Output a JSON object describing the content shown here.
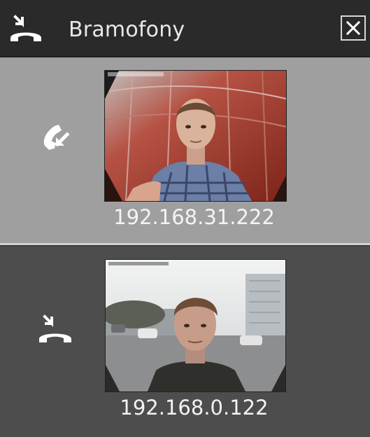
{
  "window": {
    "title": "Bramofony",
    "title_icon": "phone-hangup-icon",
    "close_icon": "close-icon"
  },
  "intercoms": [
    {
      "ip": "192.168.31.222",
      "status_icon": "incoming-call-icon",
      "highlighted": true,
      "background_color": "#9f9f9f"
    },
    {
      "ip": "192.168.0.122",
      "status_icon": "phone-hangup-icon",
      "highlighted": false,
      "background_color": "#4d4d4d"
    }
  ],
  "colors": {
    "header_bg": "#2a2a2a",
    "panel_bg": "#3d3d3d",
    "text": "#f0f0f0"
  }
}
